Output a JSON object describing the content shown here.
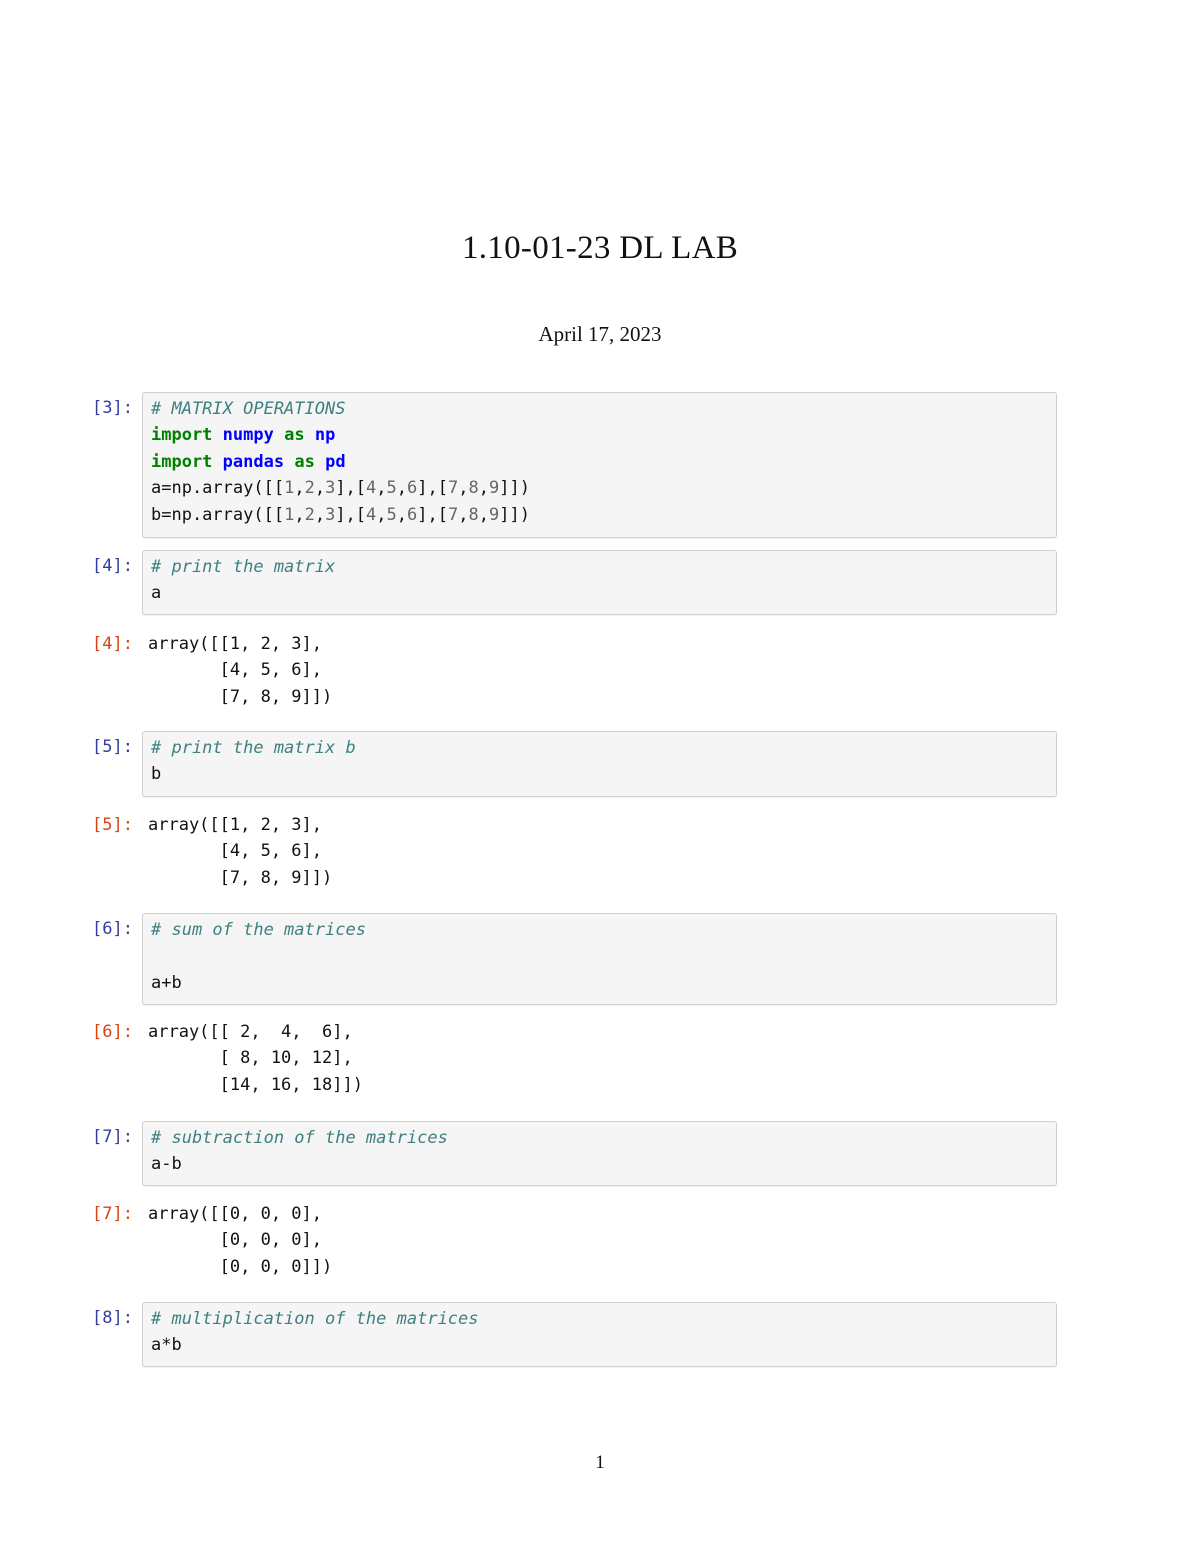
{
  "doc": {
    "title": "1.10-01-23 DL LAB",
    "date": "April 17, 2023",
    "page_number": "1"
  },
  "cells": [
    {
      "in_prompt": "[3]:",
      "lines": [
        [
          {
            "t": "# MATRIX OPERATIONS",
            "c": "cm"
          }
        ],
        [
          {
            "t": "import",
            "c": "kw"
          },
          {
            "t": " "
          },
          {
            "t": "numpy",
            "c": "nn"
          },
          {
            "t": " "
          },
          {
            "t": "as",
            "c": "kw"
          },
          {
            "t": " "
          },
          {
            "t": "np",
            "c": "nn"
          }
        ],
        [
          {
            "t": "import",
            "c": "kw"
          },
          {
            "t": " "
          },
          {
            "t": "pandas",
            "c": "nn"
          },
          {
            "t": " "
          },
          {
            "t": "as",
            "c": "kw"
          },
          {
            "t": " "
          },
          {
            "t": "pd",
            "c": "nn"
          }
        ],
        [
          {
            "t": "a=np.array([["
          },
          {
            "t": "1",
            "c": "num"
          },
          {
            "t": ","
          },
          {
            "t": "2",
            "c": "num"
          },
          {
            "t": ","
          },
          {
            "t": "3",
            "c": "num"
          },
          {
            "t": "],["
          },
          {
            "t": "4",
            "c": "num"
          },
          {
            "t": ","
          },
          {
            "t": "5",
            "c": "num"
          },
          {
            "t": ","
          },
          {
            "t": "6",
            "c": "num"
          },
          {
            "t": "],["
          },
          {
            "t": "7",
            "c": "num"
          },
          {
            "t": ","
          },
          {
            "t": "8",
            "c": "num"
          },
          {
            "t": ","
          },
          {
            "t": "9",
            "c": "num"
          },
          {
            "t": "]])"
          }
        ],
        [
          {
            "t": "b=np.array([["
          },
          {
            "t": "1",
            "c": "num"
          },
          {
            "t": ","
          },
          {
            "t": "2",
            "c": "num"
          },
          {
            "t": ","
          },
          {
            "t": "3",
            "c": "num"
          },
          {
            "t": "],["
          },
          {
            "t": "4",
            "c": "num"
          },
          {
            "t": ","
          },
          {
            "t": "5",
            "c": "num"
          },
          {
            "t": ","
          },
          {
            "t": "6",
            "c": "num"
          },
          {
            "t": "],["
          },
          {
            "t": "7",
            "c": "num"
          },
          {
            "t": ","
          },
          {
            "t": "8",
            "c": "num"
          },
          {
            "t": ","
          },
          {
            "t": "9",
            "c": "num"
          },
          {
            "t": "]])"
          }
        ]
      ]
    },
    {
      "in_prompt": "[4]:",
      "lines": [
        [
          {
            "t": "# print the matrix",
            "c": "cm"
          }
        ],
        [
          {
            "t": "a"
          }
        ]
      ],
      "out_prompt": "[4]:",
      "output": "array([[1, 2, 3],\n       [4, 5, 6],\n       [7, 8, 9]])"
    },
    {
      "in_prompt": "[5]:",
      "lines": [
        [
          {
            "t": "# print the matrix b",
            "c": "cm"
          }
        ],
        [
          {
            "t": "b"
          }
        ]
      ],
      "out_prompt": "[5]:",
      "output": "array([[1, 2, 3],\n       [4, 5, 6],\n       [7, 8, 9]])"
    },
    {
      "in_prompt": "[6]:",
      "lines": [
        [
          {
            "t": "# sum of the matrices",
            "c": "cm"
          }
        ],
        [
          {
            "t": ""
          }
        ],
        [
          {
            "t": "a+b"
          }
        ]
      ],
      "out_prompt": "[6]:",
      "output": "array([[ 2,  4,  6],\n       [ 8, 10, 12],\n       [14, 16, 18]])"
    },
    {
      "in_prompt": "[7]:",
      "lines": [
        [
          {
            "t": "# subtraction of the matrices",
            "c": "cm"
          }
        ],
        [
          {
            "t": "a-b"
          }
        ]
      ],
      "out_prompt": "[7]:",
      "output": "array([[0, 0, 0],\n       [0, 0, 0],\n       [0, 0, 0]])"
    },
    {
      "in_prompt": "[8]:",
      "lines": [
        [
          {
            "t": "# multiplication of the matrices",
            "c": "cm"
          }
        ],
        [
          {
            "t": "a*b"
          }
        ]
      ]
    }
  ]
}
